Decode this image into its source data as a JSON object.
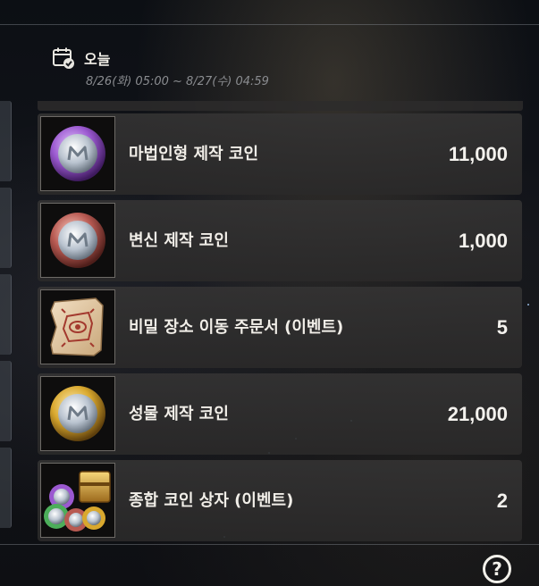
{
  "header": {
    "today_label": "오늘",
    "date_range": "8/26(화) 05:00 ~ 8/27(수) 04:59",
    "icon": "calendar-check-icon"
  },
  "items": [
    {
      "name": "마법인형 제작 코인",
      "quantity": "11,000",
      "icon": "magic-doll-coin-icon",
      "rim_color": "#9b59d0"
    },
    {
      "name": "변신 제작 코인",
      "quantity": "1,000",
      "icon": "polymorph-coin-icon",
      "rim_color": "#b85a52"
    },
    {
      "name": "비밀 장소 이동 주문서 (이벤트)",
      "quantity": "5",
      "icon": "secret-place-scroll-icon",
      "rim_color": "#c9a77a"
    },
    {
      "name": "성물 제작 코인",
      "quantity": "21,000",
      "icon": "relic-coin-icon",
      "rim_color": "#d9a82e"
    },
    {
      "name": "종합 코인 상자 (이벤트)",
      "quantity": "2",
      "icon": "coin-chest-icon",
      "rim_color": "#d8b04a"
    }
  ],
  "footer": {
    "help_label": "?",
    "help_icon": "help-icon"
  }
}
